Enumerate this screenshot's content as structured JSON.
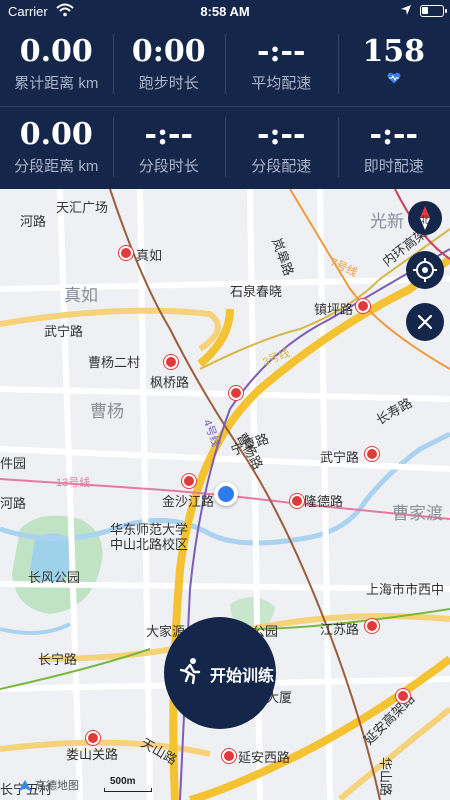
{
  "status_bar": {
    "carrier": "Carrier",
    "time": "8:58 AM"
  },
  "stats": {
    "row1": [
      {
        "value": "0.00",
        "label": "累计距离 km"
      },
      {
        "value": "0:00",
        "label": "跑步时长"
      },
      {
        "value": "-:--",
        "label": "平均配速"
      },
      {
        "value": "158",
        "label": ""
      }
    ],
    "row2": [
      {
        "value": "0.00",
        "label": "分段距离 km"
      },
      {
        "value": "-:--",
        "label": "分段时长"
      },
      {
        "value": "-:--",
        "label": "分段配速"
      },
      {
        "value": "-:--",
        "label": "即时配速"
      }
    ]
  },
  "map": {
    "compass_label": "北",
    "roads": [
      "天汇广场",
      "真如",
      "武宁路",
      "曹杨二村",
      "枫桥路",
      "曹杨",
      "曹杨路",
      "宁夏路",
      "金沙江路",
      "隆德路",
      "武宁路",
      "长寿路",
      "华东师范大学",
      "中山北路校区",
      "长风公园",
      "大家源",
      "公园",
      "江苏路",
      "长宁路",
      "娄山关路",
      "天山路",
      "延安西路",
      "延安高架路",
      "华山路",
      "镇坪路",
      "石泉春晓",
      "岚皋路",
      "内环高架",
      "光新",
      "曹家渡",
      "上海市市西中",
      "长宁五村",
      "3号线",
      "4号线",
      "7号线",
      "13号线",
      "件园",
      "河路",
      "河路",
      "长风大厦"
    ],
    "areas": [
      "真如",
      "曹杨",
      "曹家渡"
    ],
    "scale_label": "500m",
    "logo_label": "高德地图"
  },
  "start_button": {
    "label": "开始训练"
  },
  "colors": {
    "panel": "#14264a",
    "label": "#aab4c8",
    "heart": "#3a7de8",
    "metro_red": "#e23a3a",
    "line3": "#d6b84a",
    "line4": "#7b5db8",
    "line7": "#f09a3c",
    "line13": "#e8799f",
    "location_dot": "#2e7bf0"
  }
}
